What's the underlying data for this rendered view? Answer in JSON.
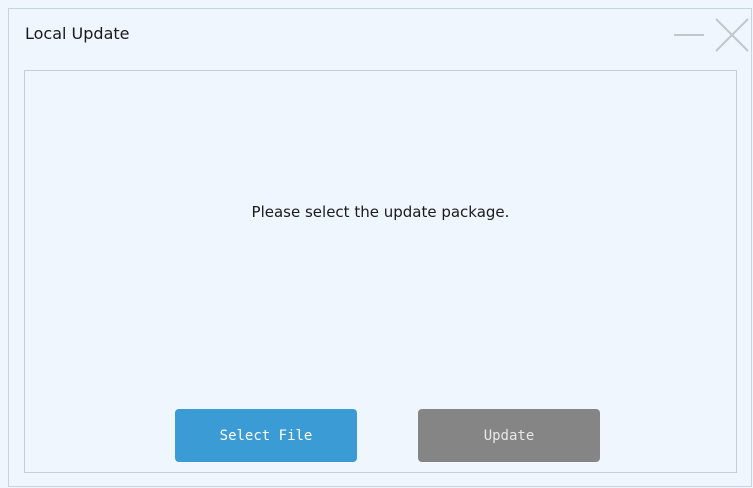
{
  "window": {
    "title": "Local Update"
  },
  "titlebar": {
    "minimize_icon": "minimize-icon",
    "close_icon": "close-icon"
  },
  "main": {
    "message": "Please select the update package."
  },
  "buttons": {
    "select_file_label": "Select File",
    "update_label": "Update"
  },
  "colors": {
    "background": "#f0f6fd",
    "select_button": "#3a9bd5",
    "update_button_disabled": "#858585"
  }
}
